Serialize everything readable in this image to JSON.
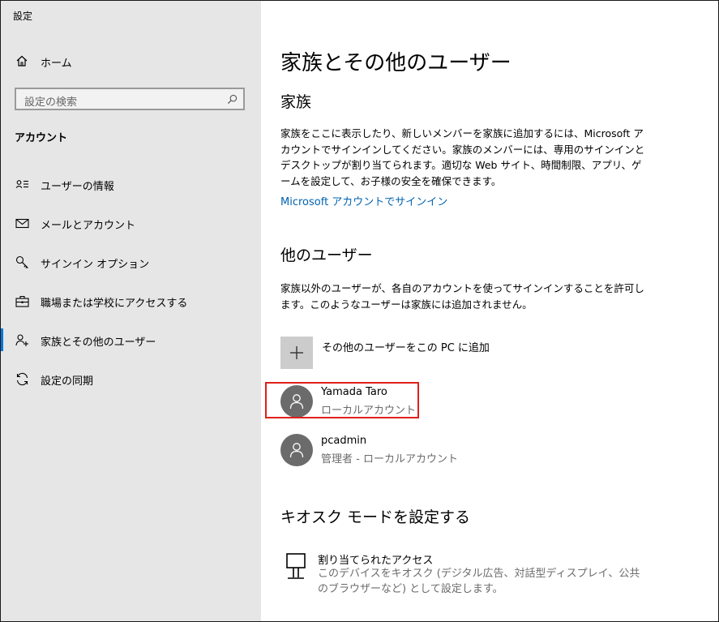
{
  "app": {
    "title": "設定"
  },
  "sidebar": {
    "home_label": "ホーム",
    "search_placeholder": "設定の検索",
    "section_label": "アカウント",
    "items": [
      {
        "label": "ユーザーの情報",
        "icon": "user-info-icon"
      },
      {
        "label": "メールとアカウント",
        "icon": "mail-icon"
      },
      {
        "label": "サインイン オプション",
        "icon": "key-icon"
      },
      {
        "label": "職場または学校にアクセスする",
        "icon": "briefcase-icon"
      },
      {
        "label": "家族とその他のユーザー",
        "icon": "family-icon",
        "active": true
      },
      {
        "label": "設定の同期",
        "icon": "sync-icon"
      }
    ]
  },
  "main": {
    "title": "家族とその他のユーザー",
    "family": {
      "heading": "家族",
      "description": "家族をここに表示したり、新しいメンバーを家族に追加するには、Microsoft アカウントでサインインしてください。家族のメンバーには、専用のサインインとデスクトップが割り当てられます。適切な Web サイト、時間制限、アプリ、ゲームを設定して、お子様の安全を確保できます。",
      "link": "Microsoft アカウントでサインイン"
    },
    "other_users": {
      "heading": "他のユーザー",
      "description": "家族以外のユーザーが、各自のアカウントを使ってサインインすることを許可します。このようなユーザーは家族には追加されません。",
      "add_label": "その他のユーザーをこの PC に追加",
      "users": [
        {
          "name": "Yamada Taro",
          "type": "ローカルアカウント"
        },
        {
          "name": "pcadmin",
          "type": "管理者 - ローカルアカウント"
        }
      ]
    },
    "kiosk": {
      "heading": "キオスク モードを設定する",
      "title": "割り当てられたアクセス",
      "description": "このデバイスをキオスク (デジタル広告、対話型ディスプレイ、公共のブラウザーなど) として設定します。"
    }
  },
  "colors": {
    "accent": "#0078d7",
    "link": "#0063b1",
    "highlight": "#e0201a",
    "sidebar_bg": "#e6e6e6"
  }
}
